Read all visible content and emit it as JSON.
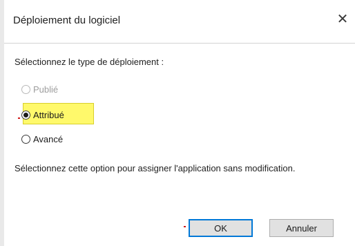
{
  "dialog": {
    "title": "Déploiement du logiciel",
    "close_label": "✕"
  },
  "content": {
    "prompt": "Sélectionnez le type de déploiement :",
    "options": [
      {
        "label": "Publié",
        "state": "disabled"
      },
      {
        "label": "Attribué",
        "state": "selected"
      },
      {
        "label": "Avancé",
        "state": "enabled"
      }
    ],
    "description": "Sélectionnez cette option pour assigner l'application sans modification."
  },
  "buttons": {
    "ok_label": "OK",
    "cancel_label": "Annuler"
  },
  "colors": {
    "highlight": "#fff96b",
    "default_button_border": "#0078d7",
    "annotation_mark": "#d11a1a"
  }
}
